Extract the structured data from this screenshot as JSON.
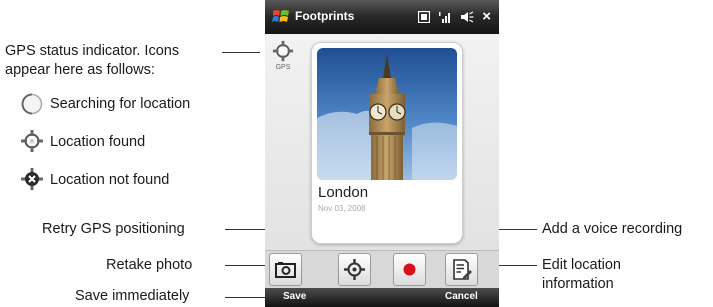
{
  "app": {
    "title": "Footprints",
    "tray_icons": [
      "connection-icon",
      "signal-icon",
      "volume-icon",
      "close-icon"
    ],
    "tray_close": "×"
  },
  "gps_indicator": {
    "label": "GPS"
  },
  "card": {
    "place": "London",
    "date": "Nov 03, 2008"
  },
  "toolbar": {
    "buttons": [
      "retake-photo-button",
      "retry-gps-button",
      "voice-record-button",
      "edit-location-button"
    ]
  },
  "softkeys": {
    "left": "Save",
    "right": "Cancel"
  },
  "annotations": {
    "gps_status": "GPS status indicator. Icons appear here as follows:",
    "gps_status_line1": "GPS status indicator. Icons",
    "gps_status_line2": "appear here as follows:",
    "searching": "Searching for location",
    "found": "Location found",
    "not_found": "Location not found",
    "retry": "Retry GPS positioning",
    "retake": "Retake photo",
    "save": "Save immediately",
    "voice": "Add a voice recording",
    "edit_line1": "Edit location",
    "edit_line2": "information"
  },
  "colors": {
    "accent": "#1f5fa8",
    "record": "#d8101c",
    "titlebar": "#1e1e1e"
  }
}
